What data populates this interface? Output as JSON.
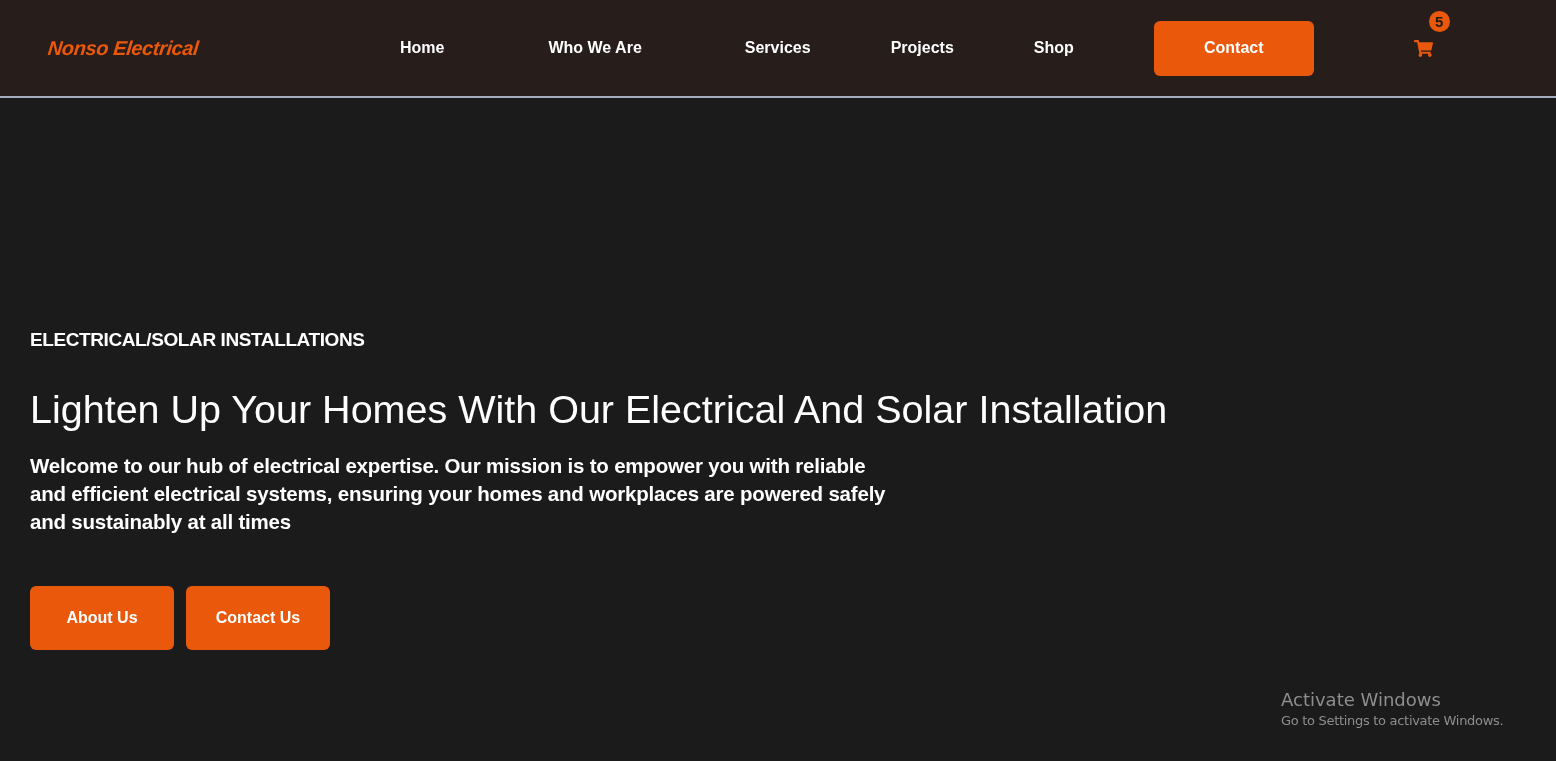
{
  "header": {
    "logo": "Nonso Electrical",
    "nav": [
      {
        "label": "Home",
        "kind": "link"
      },
      {
        "label": "Who We Are",
        "kind": "link"
      },
      {
        "label": "Services",
        "kind": "link"
      },
      {
        "label": "Projects",
        "kind": "link"
      },
      {
        "label": "Shop",
        "kind": "link"
      },
      {
        "label": "Contact",
        "kind": "button"
      }
    ],
    "cart": {
      "count": "5"
    }
  },
  "hero": {
    "eyebrow": "ELECTRICAL/SOLAR INSTALLATIONS",
    "title": "Lighten Up Your Homes With Our Electrical And Solar Installation",
    "description": "Welcome to our hub of electrical expertise. Our mission is to empower you with reliable and efficient electrical systems, ensuring your homes and workplaces are powered safely and sustainably at all times",
    "buttons": [
      "About Us",
      "Contact Us"
    ]
  },
  "os_notice": {
    "title": "Activate Windows",
    "subtitle": "Go to Settings to activate Windows."
  }
}
